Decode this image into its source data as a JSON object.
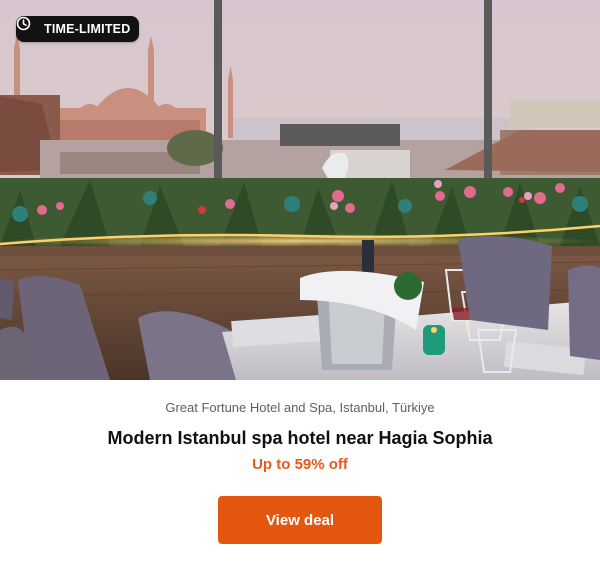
{
  "badge": {
    "icon": "clock-icon",
    "label": "TIME-LIMITED"
  },
  "hero": {
    "image": "rooftop-restaurant-view-of-hagia-sophia"
  },
  "deal": {
    "hotel_name": "Great Fortune Hotel and Spa, Istanbul, Türkiye",
    "headline": "Modern Istanbul spa hotel near Hagia Sophia",
    "discount": "Up to 59% off",
    "cta_label": "View deal"
  },
  "colors": {
    "accent": "#e4570f",
    "discount_text": "#e8591a",
    "badge_bg": "#121212"
  }
}
